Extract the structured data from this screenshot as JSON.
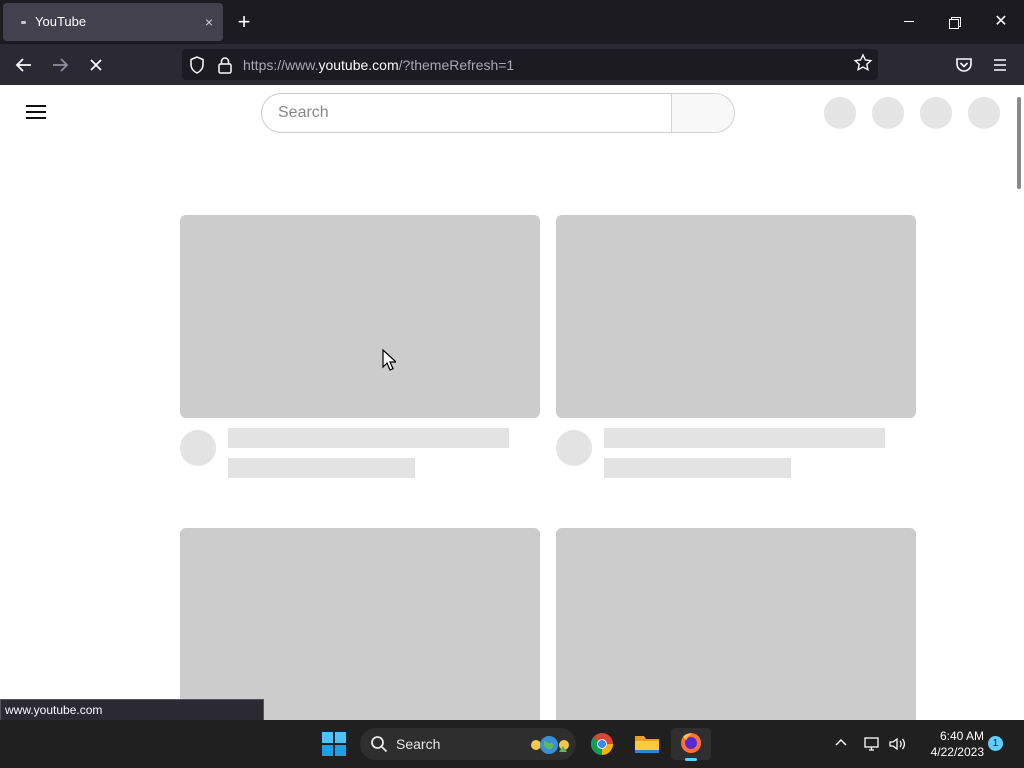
{
  "browser": {
    "tab_title": "YouTube",
    "tab_close": "×",
    "new_tab": "+",
    "url_prefix": "https://www.",
    "url_host": "youtube.com",
    "url_path": "/?themeRefresh=1",
    "status_url": "www.youtube.com"
  },
  "page": {
    "search_placeholder": "Search"
  },
  "taskbar": {
    "search_label": "Search",
    "time": "6:40 AM",
    "date": "4/22/2023",
    "notification_count": "1"
  },
  "colors": {
    "chrome_dark": "#1c1b22",
    "toolbar": "#2b2a33",
    "skeleton": "#cccccc",
    "skeleton_light": "#e3e3e3",
    "taskbar": "#202020",
    "accent": "#60cdff"
  }
}
